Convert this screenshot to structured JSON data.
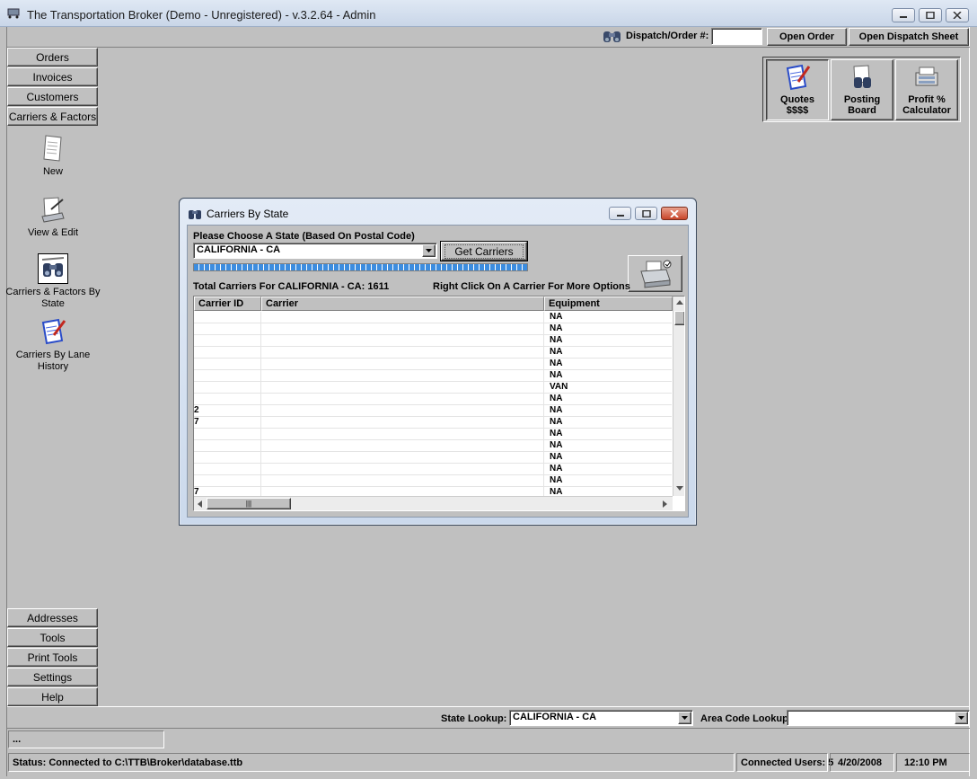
{
  "window": {
    "title": "The Transportation Broker (Demo - Unregistered) - v.3.2.64 - Admin"
  },
  "topbar": {
    "dispatch_label": "Dispatch/Order #:",
    "dispatch_value": "",
    "open_order": "Open Order",
    "open_dispatch_sheet": "Open Dispatch Sheet"
  },
  "nav_top": [
    {
      "label": "Orders"
    },
    {
      "label": "Invoices"
    },
    {
      "label": "Customers"
    },
    {
      "label": "Carriers & Factors"
    }
  ],
  "side_icons": [
    {
      "label": "New",
      "icon": "document-icon"
    },
    {
      "label": "View & Edit",
      "icon": "edit-document-icon"
    },
    {
      "label": "Carriers & Factors By State",
      "icon": "binoculars-icon"
    },
    {
      "label": "Carriers By Lane History",
      "icon": "clipboard-pencil-icon"
    }
  ],
  "nav_bottom": [
    {
      "label": "Addresses"
    },
    {
      "label": "Tools"
    },
    {
      "label": "Print Tools"
    },
    {
      "label": "Settings"
    },
    {
      "label": "Help"
    }
  ],
  "quick": {
    "quotes_line1": "Quotes",
    "quotes_line2": "$$$$",
    "posting_line1": "Posting",
    "posting_line2": "Board",
    "profit_line1": "Profit %",
    "profit_line2": "Calculator"
  },
  "dialog": {
    "title": "Carriers By State",
    "choose_label": "Please Choose A State (Based On Postal Code)",
    "state_value": "CALIFORNIA - CA",
    "get_carriers": "Get Carriers",
    "progress": 1.0,
    "total_label": "Total Carriers For CALIFORNIA - CA: 1611",
    "hint": "Right Click On A Carrier For More Options",
    "columns": [
      "Carrier ID",
      "Carrier",
      "Equipment"
    ],
    "rows": [
      {
        "id": "",
        "carrier": "",
        "equipment": "NA"
      },
      {
        "id": "",
        "carrier": "",
        "equipment": "NA"
      },
      {
        "id": "",
        "carrier": "",
        "equipment": "NA"
      },
      {
        "id": "",
        "carrier": "",
        "equipment": "NA"
      },
      {
        "id": "",
        "carrier": "",
        "equipment": "NA"
      },
      {
        "id": "",
        "carrier": "",
        "equipment": "NA"
      },
      {
        "id": "",
        "carrier": "",
        "equipment": "VAN"
      },
      {
        "id": "",
        "carrier": "",
        "equipment": "NA"
      },
      {
        "id": "2",
        "carrier": "",
        "equipment": "NA"
      },
      {
        "id": "7",
        "carrier": "",
        "equipment": "NA"
      },
      {
        "id": "",
        "carrier": "",
        "equipment": "NA"
      },
      {
        "id": "",
        "carrier": "",
        "equipment": "NA"
      },
      {
        "id": "",
        "carrier": "",
        "equipment": "NA"
      },
      {
        "id": "",
        "carrier": "",
        "equipment": "NA"
      },
      {
        "id": "",
        "carrier": "",
        "equipment": "NA"
      },
      {
        "id": "7",
        "carrier": "",
        "equipment": "NA"
      }
    ]
  },
  "lookup": {
    "state_label": "State Lookup:",
    "state_value": "CALIFORNIA - CA",
    "area_label": "Area Code Lookup:",
    "area_value": ""
  },
  "status": {
    "small_field": "...",
    "connection": "Status: Connected to C:\\TTB\\Broker\\database.ttb",
    "users": "Connected Users: 5",
    "date": "4/20/2008",
    "time": "12:10 PM"
  }
}
